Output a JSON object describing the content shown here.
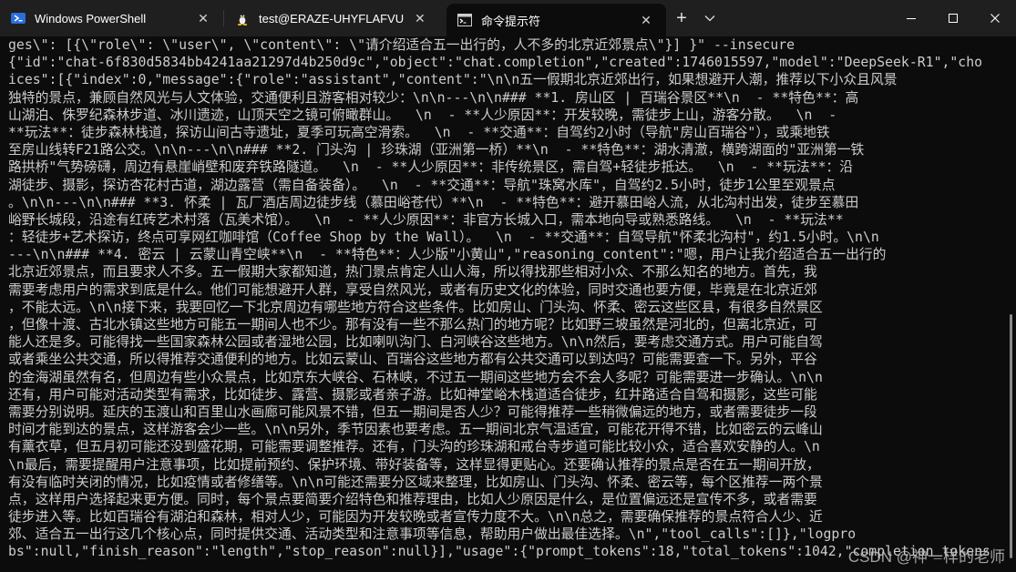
{
  "titlebar": {
    "tabs": [
      {
        "label": "Windows PowerShell",
        "icon": "powershell-icon",
        "active": false,
        "close": "✕"
      },
      {
        "label": "test@ERAZE-UHYFLAFVU: ~",
        "icon": "linux-tux-icon",
        "active": false,
        "close": "✕"
      },
      {
        "label": "命令提示符",
        "icon": "cmd-icon",
        "active": true,
        "close": "✕"
      }
    ],
    "new_tab": "+",
    "dropdown": "⌄",
    "controls": {
      "minimize": "—",
      "maximize": "☐",
      "close": "✕"
    }
  },
  "terminal": {
    "lines": [
      "ges\\\": [{\\\"role\\\": \\\"user\\\", \\\"content\\\": \\\"请介绍适合五一出行的，人不多的北京近郊景点\\\"}] }\" --insecure",
      "{\"id\":\"chat-6f830d5834bb4241aa21297d4b250d9c\",\"object\":\"chat.completion\",\"created\":1746015597,\"model\":\"DeepSeek-R1\",\"cho",
      "ices\":[{\"index\":0,\"message\":{\"role\":\"assistant\",\"content\":\"\\n\\n五一假期北京近郊出行，如果想避开人潮，推荐以下小众且风景",
      "独特的景点，兼顾自然风光与人文体验，交通便利且游客相对较少：\\n\\n---\\n\\n### **1. 房山区 | 百瑞谷景区**\\n  - **特色**：高",
      "山湖泊、侏罗纪森林步道、冰川遗迹，山顶天空之镜可俯瞰群山。  \\n  - **人少原因**：开发较晚，需徒步上山，游客分散。  \\n  -",
      "**玩法**：徒步森林栈道，探访山间古寺遗址，夏季可玩高空滑索。  \\n  - **交通**：自驾约2小时（导航\"房山百瑞谷\"），或乘地铁",
      "至房山线转F21路公交。\\n\\n---\\n\\n### **2. 门头沟 | 珍珠湖（亚洲第一桥）**\\n  - **特色**：湖水清澈，横跨湖面的\"亚洲第一铁",
      "路拱桥\"气势磅礴，周边有悬崖峭壁和废弃铁路隧道。  \\n  - **人少原因**：非传统景区，需自驾+轻徒步抵达。  \\n  - **玩法**：沿",
      "湖徒步、摄影，探访杏花村古道，湖边露营（需自备装备）。  \\n  - **交通**：导航\"珠窝水库\"，自驾约2.5小时，徒步1公里至观景点",
      "。\\n\\n---\\n\\n### **3. 怀柔 | 瓦厂酒店周边徒步线（慕田峪苍代）**\\n  - **特色**：避开慕田峪人流，从北沟村出发，徒步至慕田",
      "峪野长城段，沿途有红砖艺术村落（瓦美术馆）。  \\n  - **人少原因**：非官方长城入口，需本地向导或熟悉路线。  \\n  - **玩法**",
      "：轻徒步+艺术探访，终点可享网红咖啡馆（Coffee Shop by the Wall）。  \\n  - **交通**：自驾导航\"怀柔北沟村\"，约1.5小时。\\n\\n",
      "---\\n\\n### **4. 密云 | 云蒙山青空峡**\\n  - **特色**：人少版\"小黄山\",\"reasoning_content\":\"嗯，用户让我介绍适合五一出行的",
      "北京近郊景点，而且要求人不多。五一假期大家都知道，热门景点肯定人山人海，所以得找那些相对小众、不那么知名的地方。首先，我",
      "需要考虑用户的需求到底是什么。他们可能想避开人群，享受自然风光，或者有历史文化的体验，同时交通也要方便，毕竟是在北京近郊",
      "，不能太远。\\n\\n接下来，我要回忆一下北京周边有哪些地方符合这些条件。比如房山、门头沟、怀柔、密云这些区县，有很多自然景区",
      "，但像十渡、古北水镇这些地方可能五一期间人也不少。那有没有一些不那么热门的地方呢？比如野三坡虽然是河北的，但离北京近，可",
      "能人还是多。可能得找一些国家森林公园或者湿地公园，比如喇叭沟门、白河峡谷这些地方。\\n\\n然后，要考虑交通方式。用户可能自驾",
      "或者乘坐公共交通，所以得推荐交通便利的地方。比如云蒙山、百瑞谷这些地方都有公共交通可以到达吗？可能需要查一下。另外，平谷",
      "的金海湖虽然有名，但周边有些小众景点，比如京东大峡谷、石林峡，不过五一期间这些地方会不会人多呢？可能需要进一步确认。\\n\\n",
      "还有，用户可能对活动类型有需求，比如徒步、露营、摄影或者亲子游。比如神堂峪木栈道适合徒步，红井路适合自驾和摄影，这些可能",
      "需要分别说明。延庆的玉渡山和百里山水画廊可能风景不错，但五一期间是否人少？可能得推荐一些稍微偏远的地方，或者需要徒步一段",
      "时间才能到达的景点，这样游客会少一些。\\n\\n另外，季节因素也要考虑。五一期间北京气温适宜，可能花开得不错，比如密云的云峰山",
      "有薰衣草，但五月初可能还没到盛花期，可能需要调整推荐。还有，门头沟的珍珠湖和戒台寺步道可能比较小众，适合喜欢安静的人。\\n",
      "\\n最后，需要提醒用户注意事项，比如提前预约、保护环境、带好装备等，这样显得更贴心。还要确认推荐的景点是否在五一期间开放，",
      "有没有临时关闭的情况，比如疫情或者修缮等。\\n\\n可能还需要分区域来整理，比如房山、门头沟、怀柔、密云等，每个区推荐一两个景",
      "点，这样用户选择起来更方便。同时，每个景点要简要介绍特色和推荐理由，比如人少原因是什么，是位置偏远还是宣传不多，或者需要",
      "徒步进入等。比如百瑞谷有湖泊和森林，相对人少，可能因为开发较晚或者宣传力度不大。\\n\\n总之，需要确保推荐的景点符合人少、近",
      "郊、适合五一出行这几个核心点，同时提供交通、活动类型和注意事项等信息，帮助用户做出最佳选择。\\n\",\"tool_calls\":[]},\"logpro",
      "bs\":null,\"finish_reason\":\"length\",\"stop_reason\":null}],\"usage\":{\"prompt_tokens\":18,\"total_tokens\":1042,\"completion_tokens"
    ]
  },
  "watermark": "CSDN @神一样的老师",
  "colors": {
    "background": "#0c0c0c",
    "text": "#cccccc",
    "titlebar": "#1f1f1f"
  }
}
